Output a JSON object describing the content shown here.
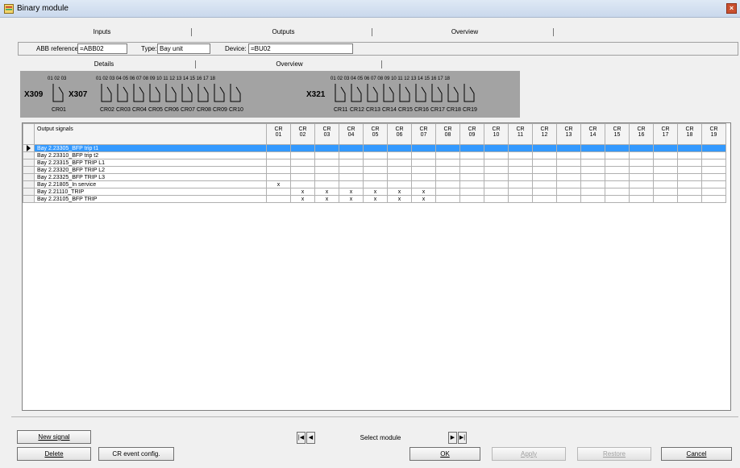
{
  "window": {
    "title": "Binary module",
    "close": "×"
  },
  "top_tabs": [
    "Inputs",
    "Outputs",
    "Overview"
  ],
  "reference": {
    "abb_label": "ABB reference:",
    "abb_value": "=ABB02",
    "type_label": "Type:",
    "type_value": "Bay unit",
    "device_label": "Device:",
    "device_value": "=BU02"
  },
  "sub_tabs": [
    "Details",
    "Overview"
  ],
  "diagram": {
    "terminals": [
      "X309",
      "X307",
      "X321"
    ],
    "pins_x309": "01 02 03",
    "pins_x307": "01 02 03 04 05 06 07 08 09 10 11 12 13 14 15 16 17 18",
    "pins_x321": "01 02 03 04 05 06 07 08 09 10 11 12 13 14 15 16 17 18",
    "cr_labels": [
      "CR01",
      "CR02",
      "CR03",
      "CR04",
      "CR05",
      "CR06",
      "CR07",
      "CR08",
      "CR09",
      "CR10",
      "CR11",
      "CR12",
      "CR13",
      "CR14",
      "CR15",
      "CR16",
      "CR17",
      "CR18",
      "CR19"
    ]
  },
  "grid": {
    "signal_header": "Output signals",
    "columns": [
      "01",
      "02",
      "03",
      "04",
      "05",
      "06",
      "07",
      "08",
      "09",
      "10",
      "11",
      "12",
      "13",
      "14",
      "15",
      "16",
      "17",
      "18",
      "19"
    ],
    "col_prefix": "CR",
    "rows": [
      {
        "name": "Bay 2.23305_BFP trip t1",
        "marks": []
      },
      {
        "name": "Bay 2.23310_BFP trip t2",
        "marks": []
      },
      {
        "name": "Bay 2.23315_BFP TRIP L1",
        "marks": []
      },
      {
        "name": "Bay 2.23320_BFP TRIP L2",
        "marks": []
      },
      {
        "name": "Bay 2.23325_BFP TRIP L3",
        "marks": []
      },
      {
        "name": "Bay 2.21805_In service",
        "marks": [
          1
        ]
      },
      {
        "name": "Bay 2.21110_TRIP",
        "marks": [
          2,
          3,
          4,
          5,
          6,
          7
        ]
      },
      {
        "name": "Bay 2.23105_BFP TRIP",
        "marks": [
          2,
          3,
          4,
          5,
          6,
          7
        ]
      }
    ],
    "selected_row": 0,
    "mark": "x"
  },
  "buttons": {
    "new_signal": "New signal",
    "delete": "Delete",
    "cr_event": "CR event config.",
    "ok": "OK",
    "apply": "Apply",
    "restore": "Restore",
    "cancel": "Cancel"
  },
  "nav": {
    "first": "|◀",
    "prev": "◀",
    "label": "Select module",
    "next": "▶",
    "last": "▶|"
  }
}
